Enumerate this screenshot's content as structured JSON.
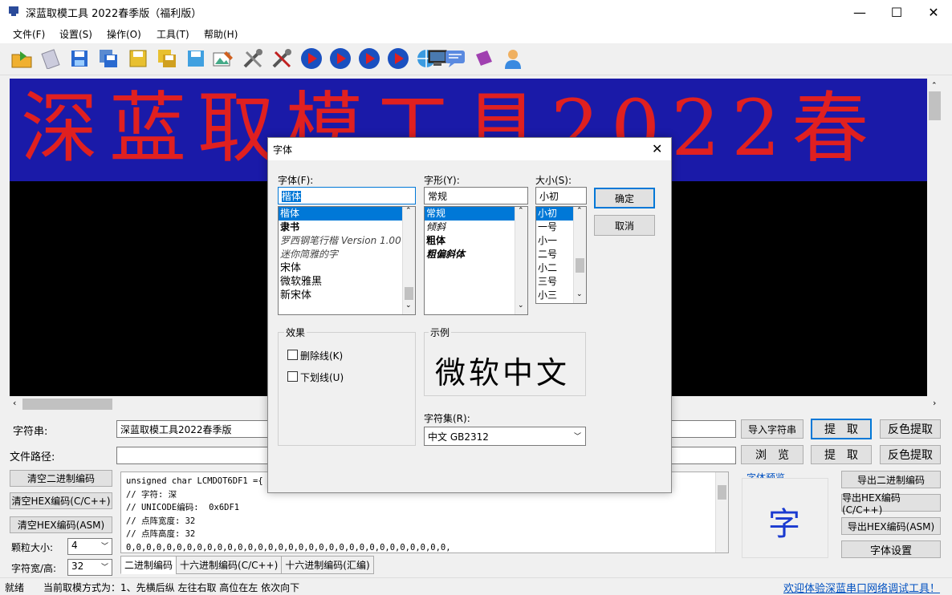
{
  "window": {
    "title": "深蓝取模工具 2022春季版（福利版）",
    "minimize": "—",
    "maximize": "☐",
    "close": "✕"
  },
  "menu": [
    "文件(F)",
    "设置(S)",
    "操作(O)",
    "工具(T)",
    "帮助(H)"
  ],
  "toolbar_icons": [
    "open-folder-icon",
    "new-file-icon",
    "save-icon",
    "save-all-icon",
    "save-disk-icon",
    "save-multi-icon",
    "save-blue-icon",
    "image-edit-icon",
    "tools-icon",
    "tools-red-icon",
    "play-1-icon",
    "play-2-icon",
    "play-3-icon",
    "play-4-icon",
    "network-icon",
    "monitor-icon",
    "message-icon",
    "book-icon",
    "user-icon"
  ],
  "led_display": {
    "text": "深蓝取模工具2022春",
    "bg": "#1a1aa8",
    "fg": "#e02020"
  },
  "form": {
    "char_label": "字符串:",
    "char_value": "深蓝取模工具2022春季版",
    "path_label": "文件路径:",
    "path_value": "",
    "import_btn": "导入字符串",
    "extract_btn": "提　取",
    "invert_extract_btn": "反色提取",
    "browse_btn": "浏　览",
    "extract_btn2": "提　取",
    "invert_extract_btn2": "反色提取",
    "clear_bin": "清空二进制编码",
    "clear_hex_c": "清空HEX编码(C/C++)",
    "clear_hex_asm": "清空HEX编码(ASM)",
    "particle_label": "颗粒大小:",
    "particle_value": "4",
    "size_label": "字符宽/高:",
    "size_value": "32",
    "export_bin": "导出二进制编码",
    "export_hex_c": "导出HEX编码(C/C++)",
    "export_hex_asm": "导出HEX编码(ASM)",
    "font_settings": "字体设置",
    "preview_label": "字体预览",
    "preview_char": "字"
  },
  "code_lines": [
    "unsigned char LCMDOT6DF1 ={",
    "// 字符: 深",
    "// UNICODE编码:  0x6DF1",
    "// 点阵宽度: 32",
    "// 点阵高度: 32",
    "0,0,0,0,0,0,0,0,0,0,0,0,0,0,0,0,0,0,0,0,0,0,0,0,0,0,0,0,0,0,0,0,"
  ],
  "tabs": [
    "二进制编码",
    "十六进制编码(C/C++)",
    "十六进制编码(汇编)"
  ],
  "status": {
    "left": "就绪",
    "mode": "当前取模方式为：1、先横后纵  左往右取  高位在左  依次向下",
    "link": "欢迎体验深蓝串口网络调试工具！"
  },
  "dialog": {
    "title": "字体",
    "font_label": "字体(F):",
    "font_value": "楷体",
    "fonts": [
      "楷体",
      "隶书",
      "罗西钢笔行楷 Version 1.00",
      "迷你简雅的字",
      "宋体",
      "微软雅黑",
      "新宋体"
    ],
    "style_label": "字形(Y):",
    "style_value": "常规",
    "styles": [
      "常规",
      "倾斜",
      "粗体",
      "粗偏斜体"
    ],
    "size_label": "大小(S):",
    "size_value": "小初",
    "sizes": [
      "小初",
      "一号",
      "小一",
      "二号",
      "小二",
      "三号",
      "小三"
    ],
    "ok": "确定",
    "cancel": "取消",
    "effects_label": "效果",
    "strike": "删除线(K)",
    "underline": "下划线(U)",
    "sample_label": "示例",
    "sample_text": "微软中文",
    "charset_label": "字符集(R):",
    "charset_value": "中文 GB2312"
  }
}
